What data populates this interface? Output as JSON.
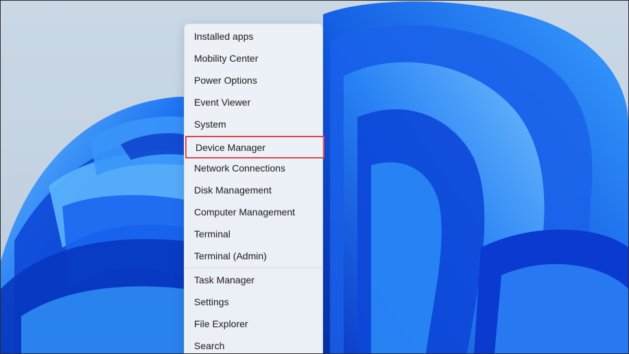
{
  "context_menu": {
    "group1": [
      "Installed apps",
      "Mobility Center",
      "Power Options",
      "Event Viewer",
      "System",
      "Device Manager",
      "Network Connections",
      "Disk Management",
      "Computer Management",
      "Terminal",
      "Terminal (Admin)"
    ],
    "group2": [
      "Task Manager",
      "Settings",
      "File Explorer",
      "Search"
    ],
    "highlighted_item": "Device Manager",
    "highlight_color": "#e3464a"
  },
  "wallpaper": {
    "name": "Windows 11 bloom",
    "background_color": "#c5d4e3",
    "accent_colors": [
      "#0a3fd6",
      "#1c6cf2",
      "#2f8ff5",
      "#5db4fb"
    ]
  }
}
